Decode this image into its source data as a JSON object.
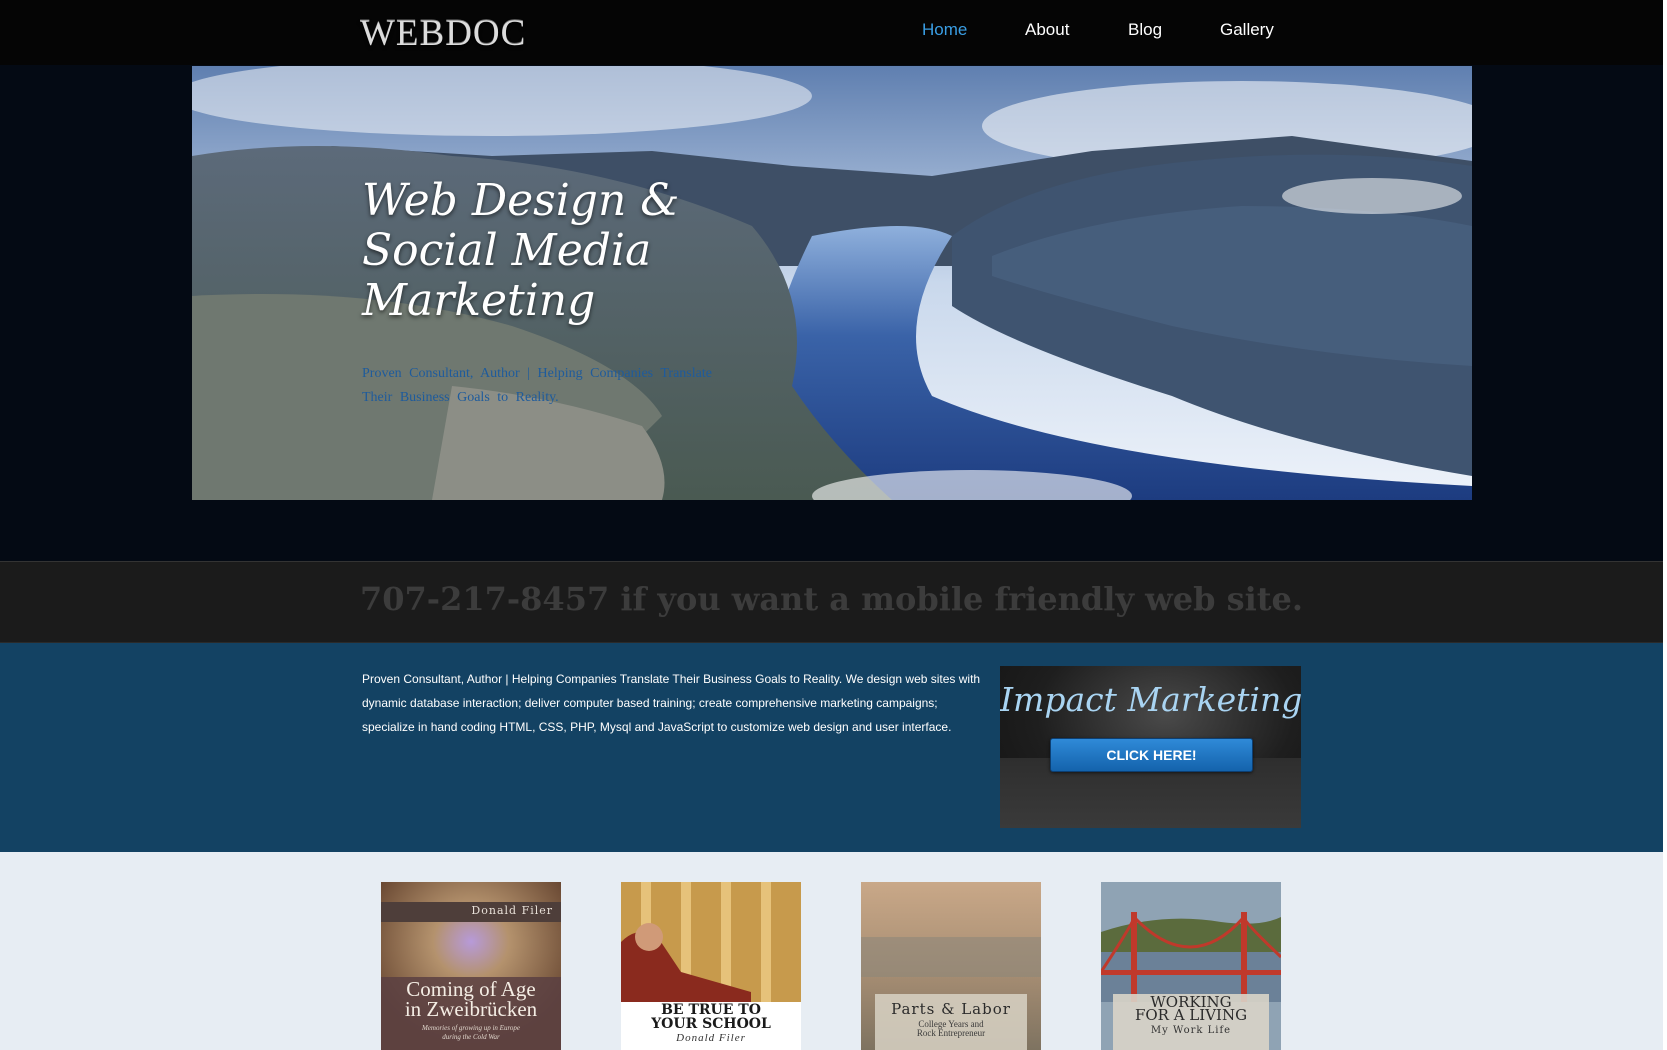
{
  "header": {
    "logo": "WEBDOC",
    "nav": [
      {
        "label": "Home",
        "active": true
      },
      {
        "label": "About",
        "active": false
      },
      {
        "label": "Blog",
        "active": false
      },
      {
        "label": "Gallery",
        "active": false
      }
    ]
  },
  "hero": {
    "title": "Web Design &\nSocial Media\nMarketing",
    "subtitle": "Proven Consultant, Author | Helping Companies Translate Their Business Goals to Reality."
  },
  "phone_band": {
    "text": "707-217-8457 if you want a mobile friendly web site."
  },
  "intro": {
    "text": "Proven Consultant, Author | Helping Companies Translate Their Business Goals to Reality. We design web sites with dynamic database interaction; deliver computer based training; create comprehensive marketing campaigns; specialize in hand coding HTML, CSS, PHP, Mysql and JavaScript to customize web design and user interface."
  },
  "promo": {
    "title": "Impact Marketing",
    "button": "CLICK HERE!"
  },
  "books": [
    {
      "author": "Donald Filer",
      "title": "Coming of Age\nin Zweibrücken",
      "subtitle": "Memories of growing up in Europe\nduring the Cold War"
    },
    {
      "title": "BE TRUE TO\nYOUR SCHOOL",
      "author": "Donald Filer"
    },
    {
      "title": "Parts & Labor",
      "subtitle": "College Years and\nRock Entrepreneur"
    },
    {
      "title": "WORKING\nFOR A LIVING",
      "subtitle": "My Work Life"
    }
  ],
  "colors": {
    "nav_active": "#3a9ee4",
    "intro_band": "#134263",
    "phone_band": "#1b1b1b",
    "page_bg": "#e7edf3"
  }
}
